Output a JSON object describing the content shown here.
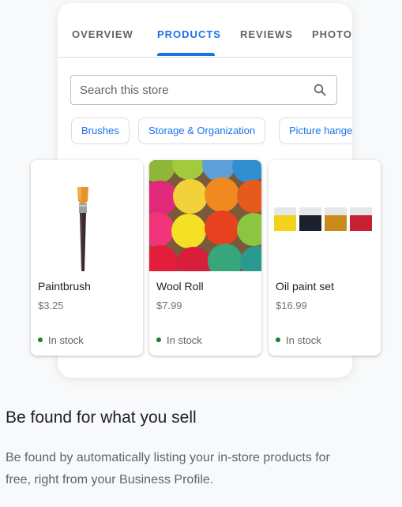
{
  "tabs": [
    {
      "label": "OVERVIEW"
    },
    {
      "label": "PRODUCTS"
    },
    {
      "label": "REVIEWS"
    },
    {
      "label": "PHOTOS"
    }
  ],
  "active_tab": "PRODUCTS",
  "search": {
    "placeholder": "Search this store"
  },
  "chips": [
    {
      "label": "Brushes"
    },
    {
      "label": "Storage & Organization"
    },
    {
      "label": "Picture hangers"
    }
  ],
  "products": [
    {
      "name": "Paintbrush",
      "price": "$3.25",
      "stock": "In stock",
      "icon": "paintbrush-image"
    },
    {
      "name": "Wool Roll",
      "price": "$7.99",
      "stock": "In stock",
      "icon": "yarn-balls-image"
    },
    {
      "name": "Oil paint set",
      "price": "$16.99",
      "stock": "In stock",
      "icon": "paint-jars-image"
    }
  ],
  "colors": {
    "accent": "#1a73e8",
    "in_stock": "#188038",
    "heading": "#202124",
    "body": "#5f6368"
  },
  "section": {
    "heading": "Be found for what you sell",
    "description": "Be found by automatically listing your in-store products for free, right from your Business Profile."
  }
}
